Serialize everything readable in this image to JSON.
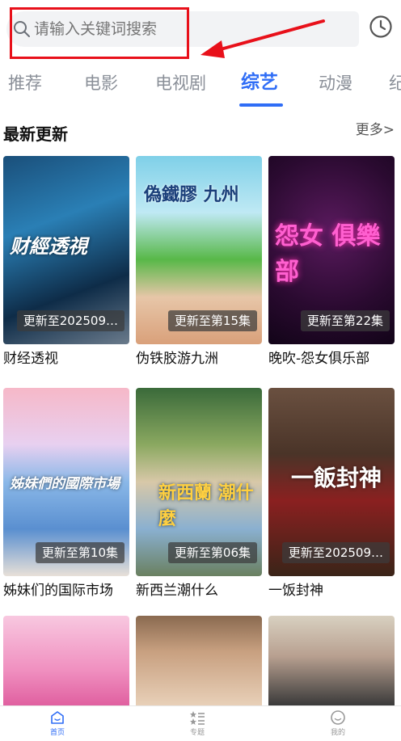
{
  "search": {
    "placeholder": "请输入关键词搜索"
  },
  "tabs": [
    {
      "label": "推荐",
      "active": false
    },
    {
      "label": "电影",
      "active": false
    },
    {
      "label": "电视剧",
      "active": false
    },
    {
      "label": "综艺",
      "active": true
    },
    {
      "label": "动漫",
      "active": false
    },
    {
      "label": "纪",
      "active": false
    }
  ],
  "section": {
    "title": "最新更新",
    "more_label": "更多>"
  },
  "cards": [
    {
      "title": "财经透视",
      "badge": "更新至202509…",
      "art_text": "财經透視"
    },
    {
      "title": "伪铁胶游九洲",
      "badge": "更新至第15集",
      "art_text": "偽鐵膠 九州"
    },
    {
      "title": "晚吹-怨女俱乐部",
      "badge": "更新至第22集",
      "art_text": "怨女 俱樂部"
    },
    {
      "title": "姊妹们的国际市场",
      "badge": "更新至第10集",
      "art_text": "姊妹們的國際市場"
    },
    {
      "title": "新西兰潮什么",
      "badge": "更新至第06集",
      "art_text": "新西蘭 潮什麼"
    },
    {
      "title": "一饭封神",
      "badge": "更新至202509…",
      "art_text": "一飯封神"
    },
    {
      "title": "",
      "badge": "",
      "art_text": ""
    },
    {
      "title": "",
      "badge": "",
      "art_text": ""
    },
    {
      "title": "",
      "badge": "",
      "art_text": ""
    }
  ],
  "bottom_nav": [
    {
      "label": "首页",
      "icon": "home-icon",
      "active": true
    },
    {
      "label": "专题",
      "icon": "topics-icon",
      "active": false
    },
    {
      "label": "我的",
      "icon": "profile-icon",
      "active": false
    }
  ],
  "colors": {
    "accent": "#2f6df6",
    "highlight_box": "#e8101a"
  }
}
